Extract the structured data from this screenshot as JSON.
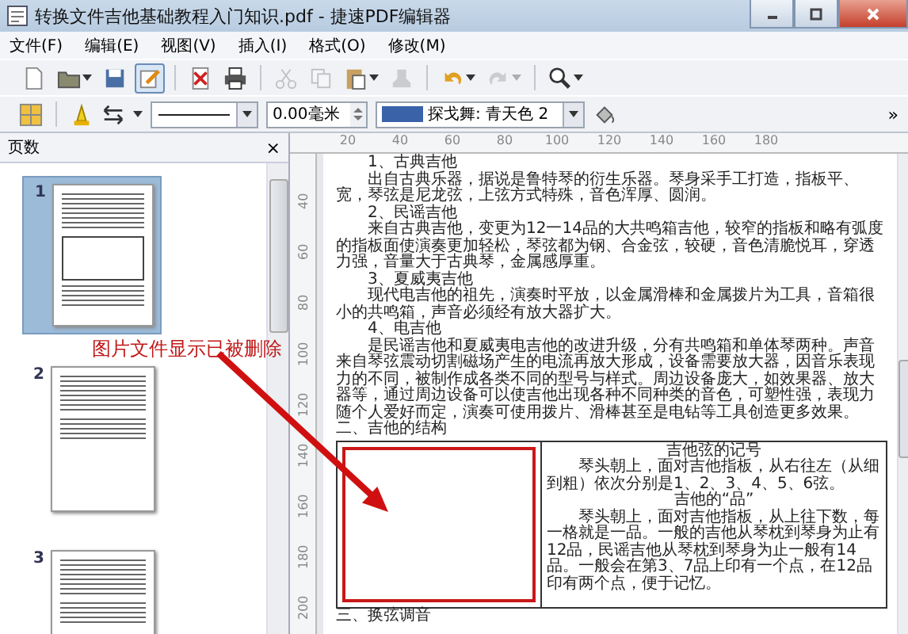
{
  "window": {
    "title": "转换文件吉他基础教程入门知识.pdf - 捷速PDF编辑器"
  },
  "menu": [
    "文件(F)",
    "编辑(E)",
    "视图(V)",
    "插入(I)",
    "格式(O)",
    "修改(M)"
  ],
  "toolbar": [
    {
      "kind": "new",
      "disabled": false,
      "pressed": false,
      "dropdown": false
    },
    {
      "kind": "open",
      "disabled": false,
      "pressed": false,
      "dropdown": true
    },
    {
      "kind": "save",
      "disabled": false,
      "pressed": false,
      "dropdown": false
    },
    {
      "kind": "edit",
      "disabled": false,
      "pressed": true,
      "dropdown": false
    },
    {
      "kind": "sep"
    },
    {
      "kind": "pdf",
      "disabled": false,
      "pressed": false,
      "dropdown": false
    },
    {
      "kind": "print",
      "disabled": false,
      "pressed": false,
      "dropdown": false
    },
    {
      "kind": "sep"
    },
    {
      "kind": "cut",
      "disabled": true,
      "pressed": false,
      "dropdown": false
    },
    {
      "kind": "copy",
      "disabled": true,
      "pressed": false,
      "dropdown": false
    },
    {
      "kind": "paste",
      "disabled": false,
      "pressed": false,
      "dropdown": true
    },
    {
      "kind": "clone",
      "disabled": true,
      "pressed": false,
      "dropdown": false
    },
    {
      "kind": "sep"
    },
    {
      "kind": "undo",
      "disabled": false,
      "pressed": false,
      "dropdown": true
    },
    {
      "kind": "redo",
      "disabled": true,
      "pressed": false,
      "dropdown": true
    },
    {
      "kind": "sep"
    },
    {
      "kind": "zoom",
      "disabled": false,
      "pressed": false,
      "dropdown": true
    }
  ],
  "format_bar": {
    "line_width": "0.00毫米",
    "fill_color": {
      "label": "探戈舞: 青天色 2",
      "color": "#3a62a8"
    },
    "overflow": "»"
  },
  "pages_panel": {
    "title": "页数",
    "close": "×",
    "pages": [
      {
        "number": "1",
        "selected": true
      },
      {
        "number": "2",
        "selected": false
      },
      {
        "number": "3",
        "selected": false
      }
    ]
  },
  "ruler": {
    "horizontal": [
      "20",
      "40",
      "60",
      "80",
      "100",
      "120",
      "140",
      "160",
      "180"
    ],
    "vertical": [
      "40",
      "60",
      "80",
      "100",
      "120",
      "140",
      "160",
      "180",
      "200"
    ]
  },
  "document": {
    "paragraphs": [
      {
        "kind": "heading",
        "text": "1、古典吉他"
      },
      {
        "kind": "body",
        "text": "出自古典乐器，据说是鲁特琴的衍生乐器。琴身采手工打造，指板平、宽，琴弦是尼龙弦，上弦方式特殊，音色浑厚、圆润。"
      },
      {
        "kind": "heading",
        "text": "2、民谣吉他"
      },
      {
        "kind": "body",
        "text": "来自古典吉他，变更为12一14品的大共鸣箱吉他，较窄的指板和略有弧度的指板面使演奏更加轻松，琴弦都为钢、合金弦，较硬，音色清脆悦耳，穿透力强，音量大于古典琴，金属感厚重。"
      },
      {
        "kind": "heading",
        "text": "3、夏威夷吉他"
      },
      {
        "kind": "body",
        "text": "现代电吉他的祖先，演奏时平放，以金属滑棒和金属拨片为工具，音箱很小的共鸣箱，声音必须经有放大器扩大。"
      },
      {
        "kind": "heading",
        "text": "4、电吉他"
      },
      {
        "kind": "body",
        "text": "是民谣吉他和夏威夷电吉他的改进升级，分有共鸣箱和单体琴两种。声音来自琴弦震动切割磁场产生的电流再放大形成，设备需要放大器，因音乐表现力的不同，被制作成各类不同的型号与样式。周边设备庞大，如效果器、放大器等，通过周边设备可以使吉他出现各种不同种类的音色，可塑性强，表现力随个人爱好而定，演奏可使用拨片、滑棒甚至是电钻等工具创造更多效果。"
      },
      {
        "kind": "section",
        "text": "二、吉他的结构"
      }
    ],
    "table_right": [
      {
        "kind": "title",
        "text": "吉他弦的记号"
      },
      {
        "kind": "body",
        "text": "琴头朝上，面对吉他指板，从右往左（从细到粗）依次分别是1、2、3、4、5、6弦。"
      },
      {
        "kind": "title",
        "text": "吉他的“品”"
      },
      {
        "kind": "body",
        "text": "琴头朝上，面对吉他指板，从上往下数，每一格就是一品。一般的吉他从琴枕到琴身为止有12品，民谣吉他从琴枕到琴身为止一般有14品。一般会在第3、7品上印有一个点，在12品印有两个点，便于记忆。"
      }
    ],
    "after": "三、换弦调音"
  },
  "annotation": "图片文件显示已被删除"
}
